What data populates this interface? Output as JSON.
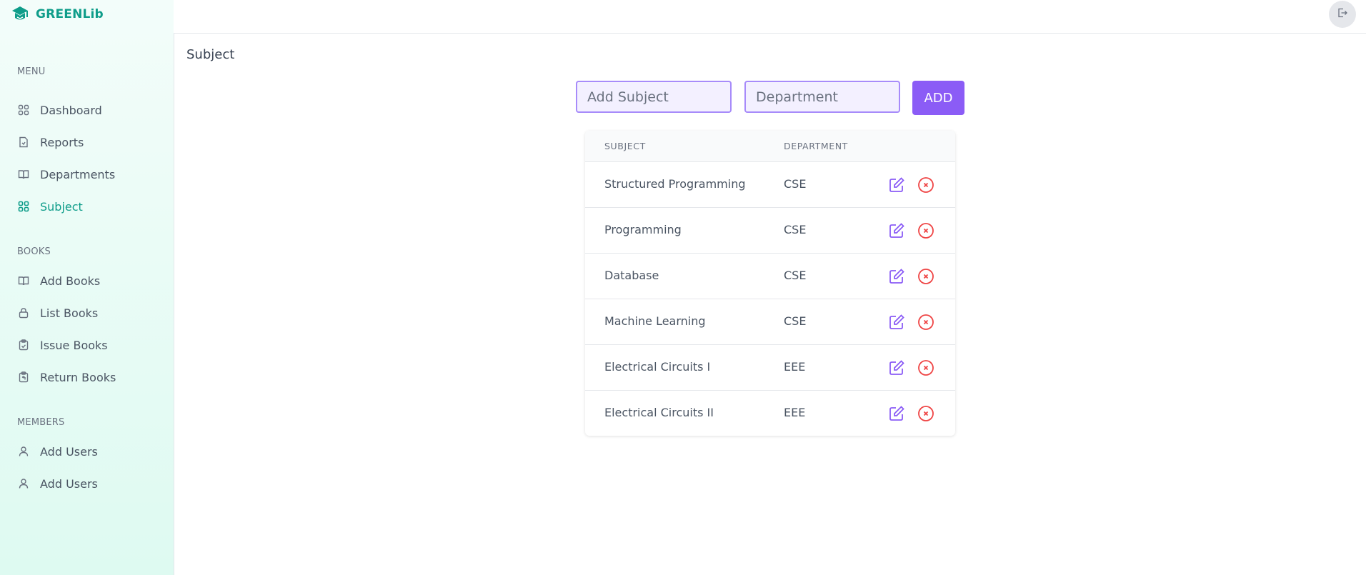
{
  "brand": {
    "name": "GREENLib"
  },
  "colors": {
    "accent": "#0f9d8a",
    "primary": "#8b5cf6",
    "danger": "#ef4444",
    "sidebar_bg": "#defaf1"
  },
  "sidebar": {
    "sections": [
      {
        "title": "MENU",
        "items": [
          {
            "label": "Dashboard",
            "icon": "grid-icon"
          },
          {
            "label": "Reports",
            "icon": "document-icon"
          },
          {
            "label": "Departments",
            "icon": "book-open-icon"
          },
          {
            "label": "Subject",
            "icon": "grid-icon",
            "active": true
          }
        ]
      },
      {
        "title": "BOOKS",
        "items": [
          {
            "label": "Add Books",
            "icon": "book-open-icon"
          },
          {
            "label": "List Books",
            "icon": "lock-icon"
          },
          {
            "label": "Issue Books",
            "icon": "clipboard-check-icon"
          },
          {
            "label": "Return Books",
            "icon": "clipboard-return-icon"
          }
        ]
      },
      {
        "title": "MEMBERS",
        "items": [
          {
            "label": "Add Users",
            "icon": "user-icon"
          },
          {
            "label": "Add Users",
            "icon": "user-icon"
          }
        ]
      }
    ]
  },
  "topbar": {
    "logout_icon": "logout-icon"
  },
  "page": {
    "title": "Subject"
  },
  "form": {
    "subject_placeholder": "Add Subject",
    "department_placeholder": "Department",
    "add_label": "ADD"
  },
  "table": {
    "headers": [
      "SUBJECT",
      "DEPARTMENT"
    ],
    "rows": [
      {
        "subject": "Structured Programming",
        "department": "CSE"
      },
      {
        "subject": "Programming",
        "department": "CSE"
      },
      {
        "subject": "Database",
        "department": "CSE"
      },
      {
        "subject": "Machine Learning",
        "department": "CSE"
      },
      {
        "subject": "Electrical Circuits I",
        "department": "EEE"
      },
      {
        "subject": "Electrical Circuits II",
        "department": "EEE"
      }
    ]
  }
}
